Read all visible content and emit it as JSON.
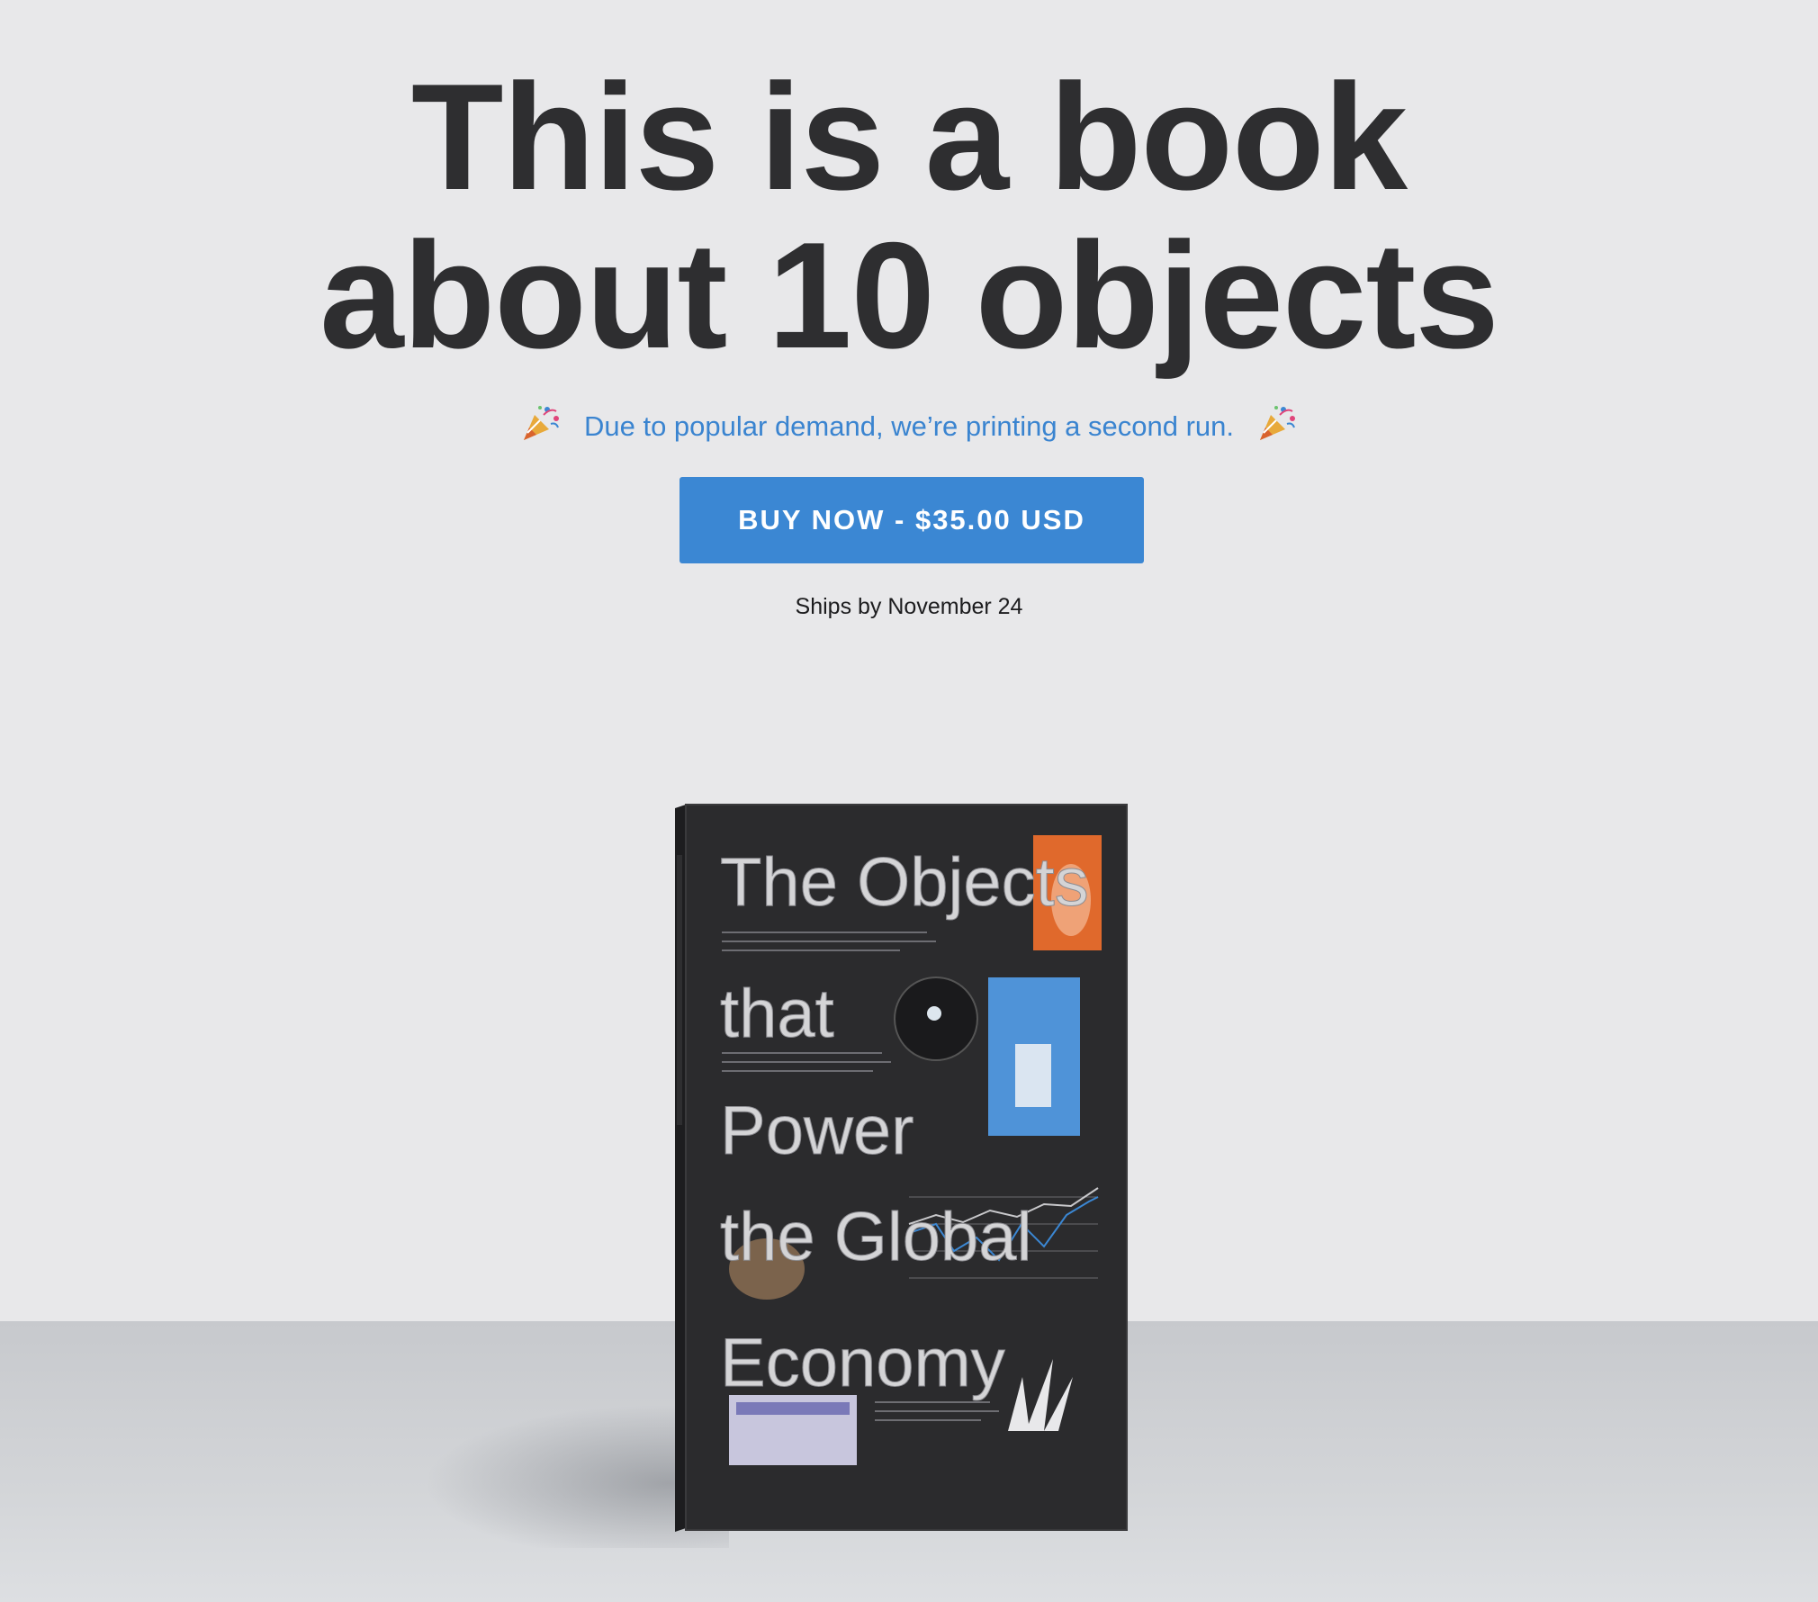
{
  "hero": {
    "title_line1": "This is a book",
    "title_line2": "about 10 objects",
    "announcement": "Due to popular demand, we’re printing a second run.",
    "left_icon": "party-popper-icon",
    "right_icon": "party-popper-icon",
    "buy_button_label": "BUY NOW - $35.00 USD",
    "ships_text": "Ships by November 24"
  },
  "book": {
    "title_lines": [
      "The Objects",
      "that",
      "Power",
      "the Global",
      "Economy"
    ]
  },
  "colors": {
    "background": "#e8e8ea",
    "title": "#2e2e30",
    "accent": "#3b87d3",
    "announcement": "#3a84d0",
    "book_cover": "#2b2b2d"
  }
}
